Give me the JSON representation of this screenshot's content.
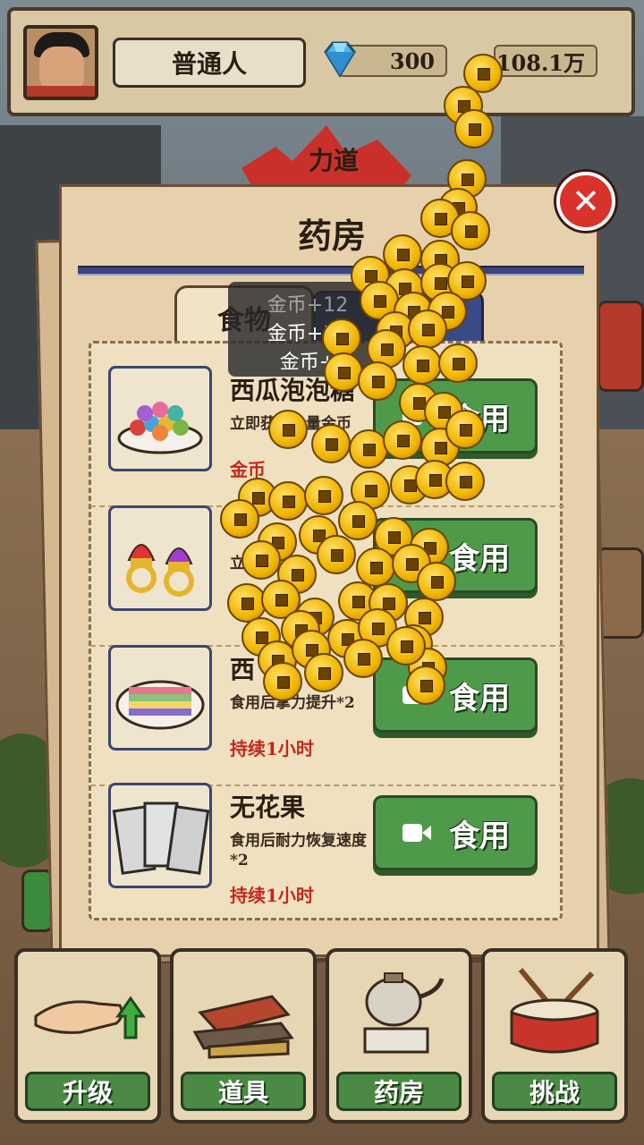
{
  "topbar": {
    "rank_title": "普通人",
    "gems": "300",
    "coins": "108.1万"
  },
  "background": {
    "power_label": "力道"
  },
  "panel": {
    "title": "药房",
    "tab_label": "食物",
    "floating_rewards": [
      "金币+12",
      "金币+12",
      "金币+"
    ],
    "use_label": "食用",
    "items": [
      {
        "name": "西瓜泡泡糖",
        "desc": "立即获得大量金币",
        "duration": "金币",
        "icon": "candy-bowl-icon"
      },
      {
        "name": "",
        "desc": "立即",
        "duration": "",
        "icon": "ring-pop-icon"
      },
      {
        "name": "西",
        "desc": "食用后掌力提升*2",
        "duration": "持续1小时",
        "icon": "layer-cake-icon"
      },
      {
        "name": "无花果",
        "desc": "食用后耐力恢复速度*2",
        "duration": "持续1小时",
        "icon": "snack-packs-icon"
      }
    ]
  },
  "nav": [
    {
      "label": "升级",
      "icon": "palm-upgrade-icon"
    },
    {
      "label": "道具",
      "icon": "bricks-icon"
    },
    {
      "label": "药房",
      "icon": "teapot-icon"
    },
    {
      "label": "挑战",
      "icon": "drum-icon"
    }
  ],
  "colors": {
    "panel_bg": "#e7d1ad",
    "button_green": "#4f9a4a",
    "accent_red": "#c4281c",
    "tab_blue": "#3a4a86",
    "coin_gold": "#f0b400"
  }
}
